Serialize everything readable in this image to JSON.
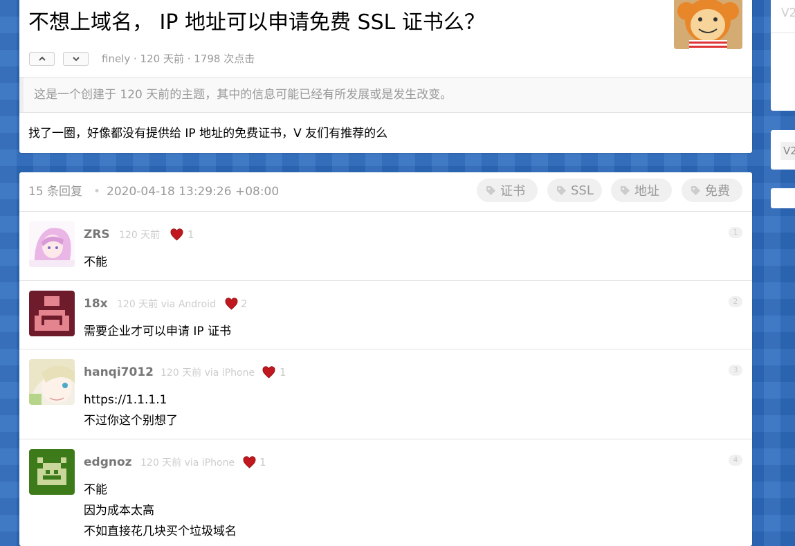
{
  "topic": {
    "title": "不想上域名， IP 地址可以申请免费 SSL 证书么？",
    "author": "finely",
    "meta_sep1": " · ",
    "time_ago": "120 天前",
    "meta_sep2": " · ",
    "clicks": "1798 次点击",
    "outdated_notice": "这是一个创建于 120 天前的主题，其中的信息可能已经有所发展或是发生改变。",
    "body": "找了一圈，好像都没有提供给 IP 地址的免费证书，V 友们有推荐的么",
    "upvote_icon": "chevron-up-icon",
    "downvote_icon": "chevron-down-icon"
  },
  "replies_header": {
    "count": "15 条回复",
    "separator": "•",
    "datetime": "2020-04-18 13:29:26 +08:00",
    "tags": [
      "证书",
      "SSL",
      "地址",
      "免费"
    ]
  },
  "replies": [
    {
      "user": "ZRS",
      "time": "120 天前",
      "likes": "1",
      "floor": "1",
      "content": [
        "不能"
      ]
    },
    {
      "user": "18x",
      "time": "120 天前 via Android",
      "likes": "2",
      "floor": "2",
      "content": [
        "需要企业才可以申请 IP 证书"
      ]
    },
    {
      "user": "hanqi7012",
      "time": "120 天前 via iPhone",
      "likes": "1",
      "floor": "3",
      "content": [
        "https://1.1.1.1",
        "不过你这个别想了"
      ]
    },
    {
      "user": "edgnoz",
      "time": "120 天前 via iPhone",
      "likes": "1",
      "floor": "4",
      "content": [
        "不能",
        "因为成本太高",
        "不如直接花几块买个垃圾域名"
      ]
    }
  ],
  "sidebar": {
    "top_text": "V2",
    "chip_text": "V2"
  },
  "colors": {
    "background": "#2e6dc0",
    "heart": "#c0181e",
    "muted_text": "#999999"
  }
}
